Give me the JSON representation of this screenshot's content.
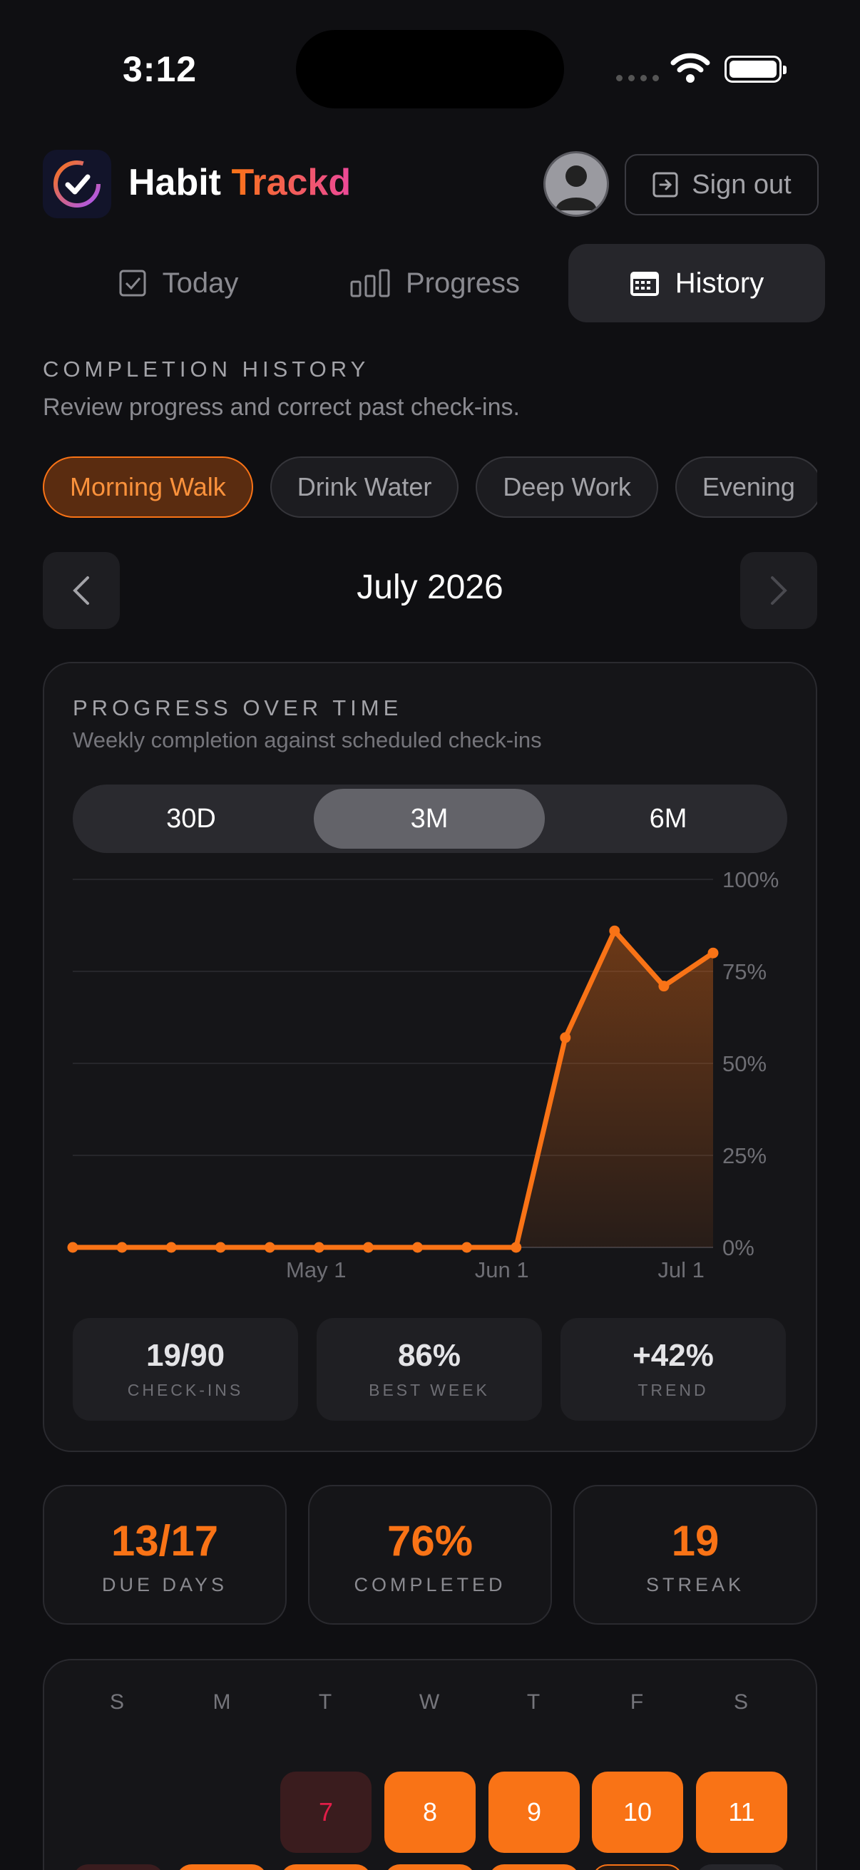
{
  "status_bar": {
    "time": "3:12"
  },
  "app": {
    "brand_part1": "Habit",
    "brand_part2": "Trackd",
    "sign_out_label": "Sign out"
  },
  "tabs": [
    {
      "label": "Today",
      "icon": "checkbox-icon",
      "active": false
    },
    {
      "label": "Progress",
      "icon": "bar-chart-icon",
      "active": false
    },
    {
      "label": "History",
      "icon": "calendar-icon",
      "active": true
    }
  ],
  "section": {
    "title": "COMPLETION HISTORY",
    "subtitle": "Review progress and correct past check-ins."
  },
  "habits": [
    {
      "label": "Morning Walk",
      "active": true
    },
    {
      "label": "Drink Water",
      "active": false
    },
    {
      "label": "Deep Work",
      "active": false
    },
    {
      "label": "Evening",
      "active": false
    }
  ],
  "month_nav": {
    "label": "July 2026"
  },
  "progress_card": {
    "title": "PROGRESS OVER TIME",
    "subtitle": "Weekly completion against scheduled check-ins",
    "ranges": [
      "30D",
      "3M",
      "6M"
    ],
    "selected_range": "3M",
    "stats": [
      {
        "value": "19/90",
        "label": "CHECK-INS"
      },
      {
        "value": "86%",
        "label": "BEST WEEK"
      },
      {
        "value": "+42%",
        "label": "TREND"
      }
    ]
  },
  "chart_data": {
    "type": "area",
    "x_tick_labels": [
      "May 1",
      "Jun 1",
      "Jul 1"
    ],
    "y_tick_labels": [
      "100%",
      "75%",
      "50%",
      "25%",
      "0%"
    ],
    "ylim": [
      0,
      100
    ],
    "grid": true,
    "color": "#f97316",
    "series": [
      {
        "values": [
          0,
          0,
          0,
          0,
          0,
          0,
          0,
          0,
          0,
          0,
          57,
          86,
          71,
          80
        ]
      }
    ]
  },
  "summary": [
    {
      "value": "13/17",
      "label": "DUE DAYS"
    },
    {
      "value": "76%",
      "label": "COMPLETED"
    },
    {
      "value": "19",
      "label": "STREAK"
    }
  ],
  "calendar": {
    "weekdays": [
      "S",
      "M",
      "T",
      "W",
      "T",
      "F",
      "S"
    ],
    "first_row": [
      {
        "day": "7",
        "status": "missed"
      },
      {
        "day": "8",
        "status": "done"
      },
      {
        "day": "9",
        "status": "done"
      },
      {
        "day": "10",
        "status": "done"
      },
      {
        "day": "11",
        "status": "done"
      }
    ]
  }
}
